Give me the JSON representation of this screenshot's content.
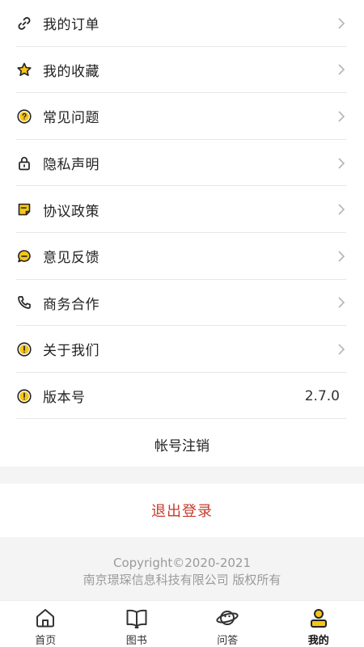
{
  "menu": {
    "items": [
      {
        "label": "我的订单",
        "icon": "link-icon"
      },
      {
        "label": "我的收藏",
        "icon": "star-icon"
      },
      {
        "label": "常见问题",
        "icon": "question-circle-icon"
      },
      {
        "label": "隐私声明",
        "icon": "lock-icon"
      },
      {
        "label": "协议政策",
        "icon": "note-icon"
      },
      {
        "label": "意见反馈",
        "icon": "chat-bubble-icon"
      },
      {
        "label": "商务合作",
        "icon": "phone-icon"
      },
      {
        "label": "关于我们",
        "icon": "info-circle-icon"
      }
    ],
    "version": {
      "label": "版本号",
      "value": "2.7.0",
      "icon": "info-circle-icon"
    }
  },
  "account": {
    "cancel_label": "帐号注销",
    "logout_label": "退出登录"
  },
  "footer": {
    "copyright": "Copyright©2020-2021",
    "company": "南京璟琛信息科技有限公司 版权所有"
  },
  "tabbar": {
    "tabs": [
      {
        "label": "首页",
        "icon": "home-icon"
      },
      {
        "label": "图书",
        "icon": "book-icon"
      },
      {
        "label": "问答",
        "icon": "planet-icon"
      },
      {
        "label": "我的",
        "icon": "user-icon",
        "active": true
      }
    ]
  },
  "colors": {
    "accent": "#f5c518",
    "logout": "#c83a2c",
    "background": "#f4f4f4"
  }
}
